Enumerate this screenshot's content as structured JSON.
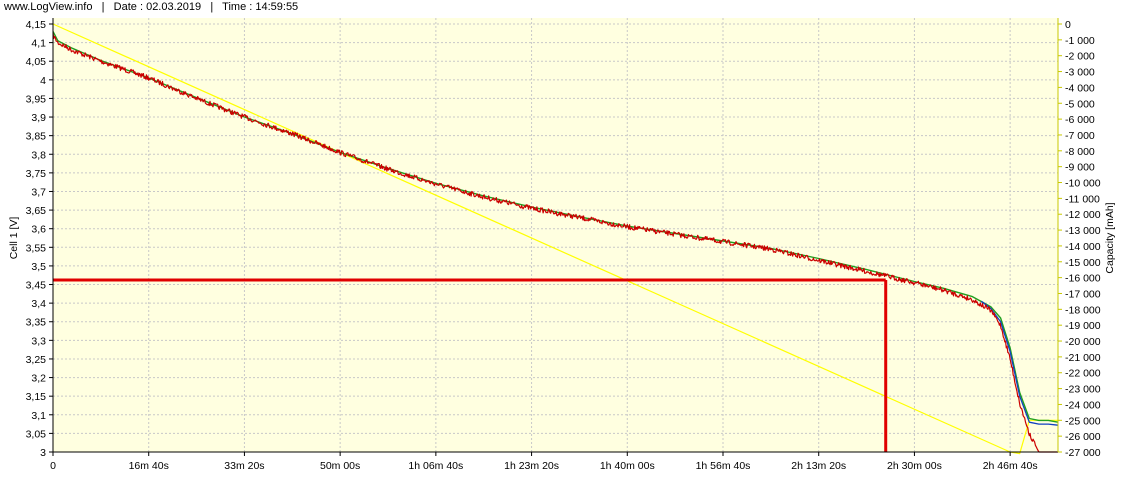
{
  "header": {
    "site": "www.LogView.info",
    "sep": "|",
    "date": "Date : 02.03.2019",
    "time": "Time : 14:59:55"
  },
  "colors": {
    "plot_bg": "#ffffe0",
    "grid": "#c8c8c8",
    "cell_voltage": "#cc0000",
    "cell_voltage_smoothed": "#20a020",
    "blue_trace": "#1040c0",
    "capacity": "#ffff00",
    "marker": "#e00000",
    "right_axis": "#c8c800"
  },
  "chart_data": {
    "type": "line",
    "ylabel": "Cell 1 [V]",
    "y2label": "Capacity [mAh]",
    "ylim": [
      3.0,
      4.15
    ],
    "y2lim": [
      -27000,
      0
    ],
    "grid": true,
    "x_ticks": [
      "0",
      "16m 40s",
      "33m 20s",
      "50m 00s",
      "1h 06m 40s",
      "1h 23m 20s",
      "1h 40m 00s",
      "1h 56m 40s",
      "2h 13m 20s",
      "2h 30m 00s",
      "2h 46m 40s"
    ],
    "x_tick_seconds": [
      0,
      1000,
      2000,
      3000,
      4000,
      5000,
      6000,
      7000,
      8000,
      9000,
      10000
    ],
    "y_ticks": [
      "4,15",
      "4,1",
      "4,05",
      "4",
      "3,95",
      "3,9",
      "3,85",
      "3,8",
      "3,75",
      "3,7",
      "3,65",
      "3,6",
      "3,55",
      "3,5",
      "3,45",
      "3,4",
      "3,35",
      "3,3",
      "3,25",
      "3,2",
      "3,15",
      "3,1",
      "3,05",
      "3"
    ],
    "y2_ticks": [
      "0",
      "-1 000",
      "-2 000",
      "-3 000",
      "-4 000",
      "-5 000",
      "-6 000",
      "-7 000",
      "-8 000",
      "-9 000",
      "-10 000",
      "-11 000",
      "-12 000",
      "-13 000",
      "-14 000",
      "-15 000",
      "-16 000",
      "-17 000",
      "-18 000",
      "-19 000",
      "-20 000",
      "-21 000",
      "-22 000",
      "-23 000",
      "-24 000",
      "-25 000",
      "-26 000",
      "-27 000"
    ],
    "series": [
      {
        "key": "voltage",
        "axis": "left",
        "x": [
          0,
          50,
          200,
          500,
          1000,
          1500,
          2000,
          2500,
          3000,
          3500,
          4000,
          4500,
          5000,
          5500,
          6000,
          6500,
          7000,
          7500,
          8000,
          8500,
          9000,
          9300,
          9600,
          9800,
          9900,
          10000,
          10100,
          10200,
          10300,
          10400,
          10500
        ],
        "y": [
          4.12,
          4.1,
          4.08,
          4.05,
          4.005,
          3.95,
          3.9,
          3.855,
          3.805,
          3.76,
          3.72,
          3.685,
          3.655,
          3.63,
          3.605,
          3.585,
          3.565,
          3.545,
          3.515,
          3.485,
          3.455,
          3.435,
          3.41,
          3.38,
          3.34,
          3.25,
          3.13,
          3.05,
          3.0,
          3.0,
          3.0
        ]
      },
      {
        "key": "voltage_green",
        "axis": "left",
        "x": [
          0,
          50,
          200,
          500,
          1000,
          1500,
          2000,
          2500,
          3000,
          3500,
          4000,
          4500,
          5000,
          5500,
          6000,
          6500,
          7000,
          7500,
          8000,
          8500,
          9000,
          9300,
          9600,
          9800,
          9900,
          10000,
          10100,
          10200,
          10300,
          10400,
          10500
        ],
        "y": [
          4.13,
          4.105,
          4.085,
          4.052,
          4.005,
          3.952,
          3.9,
          3.855,
          3.805,
          3.762,
          3.722,
          3.688,
          3.658,
          3.632,
          3.607,
          3.587,
          3.567,
          3.547,
          3.52,
          3.49,
          3.458,
          3.44,
          3.418,
          3.39,
          3.36,
          3.28,
          3.16,
          3.09,
          3.085,
          3.085,
          3.08
        ]
      },
      {
        "key": "voltage_blue",
        "axis": "left",
        "x": [
          9700,
          9800,
          9900,
          10000,
          10100,
          10200,
          10300,
          10400,
          10500
        ],
        "y": [
          3.405,
          3.385,
          3.35,
          3.27,
          3.15,
          3.08,
          3.075,
          3.075,
          3.072
        ]
      },
      {
        "key": "capacity",
        "axis": "right",
        "x": [
          0,
          10000,
          10100,
          10200,
          10500
        ],
        "y": [
          0,
          -27000,
          -27100,
          -25000,
          -25000
        ]
      }
    ],
    "marker": {
      "x": 8700,
      "y": 3.462
    }
  }
}
